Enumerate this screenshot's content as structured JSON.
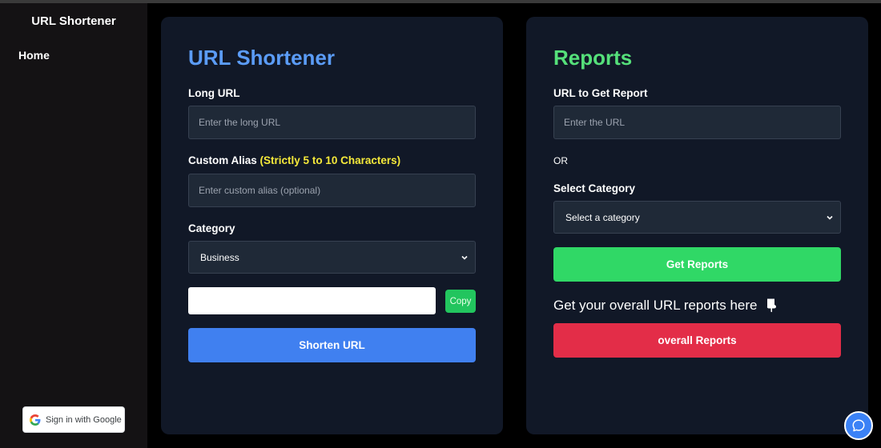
{
  "sidebar": {
    "brand": "URL Shortener",
    "nav": {
      "home": "Home"
    },
    "google_signin": {
      "label": "Sign in with Google",
      "icon": "google-g-icon"
    }
  },
  "shortener": {
    "title": "URL Shortener",
    "long_url_label": "Long URL",
    "long_url_placeholder": "Enter the long URL",
    "alias_label": "Custom Alias",
    "alias_hint": "(Strictly 5 to 10 Characters)",
    "alias_placeholder": "Enter custom alias (optional)",
    "category_label": "Category",
    "category_selected": "Business",
    "result_value": "",
    "copy_label": "Copy",
    "submit_label": "Shorten URL"
  },
  "reports": {
    "title": "Reports",
    "url_label": "URL to Get Report",
    "url_placeholder": "Enter the URL",
    "or_text": "OR",
    "category_label": "Select Category",
    "category_selected": "Select a category",
    "get_reports_label": "Get Reports",
    "overall_text": "Get your overall URL reports here",
    "overall_icon": "pointing-down-hand-icon",
    "overall_button_label": "overall Reports"
  },
  "chat": {
    "icon": "chat-bubble-icon"
  },
  "colors": {
    "shortener_title": "#5b9cf7",
    "reports_title": "#55e07a",
    "alias_hint": "#f5e93a",
    "primary_button": "#4080f0",
    "success_button": "#30d866",
    "danger_button": "#e32d48",
    "card_bg": "#111827"
  }
}
